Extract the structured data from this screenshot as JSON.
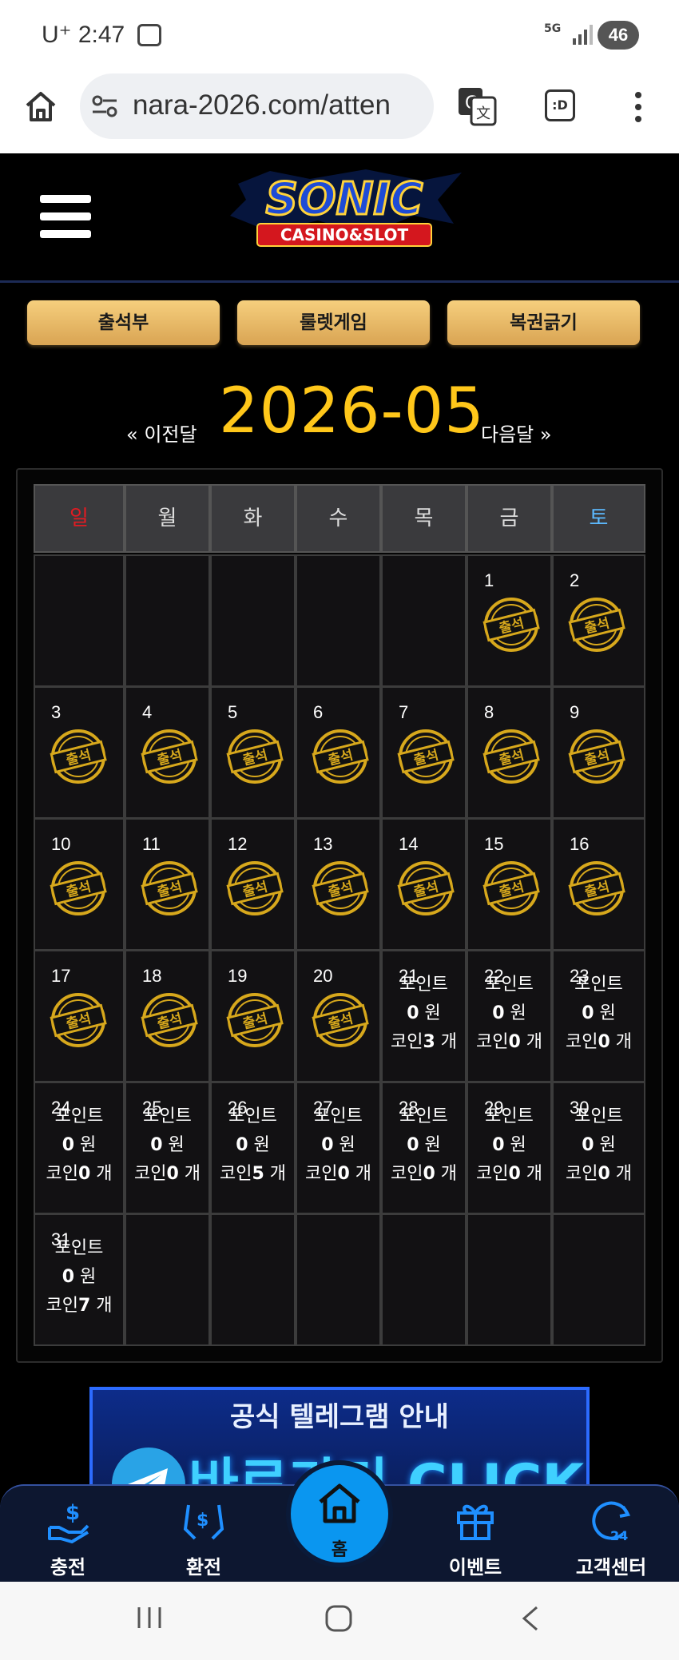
{
  "status_bar": {
    "carrier": "U⁺",
    "time": "2:47",
    "network": "5G",
    "battery": "46"
  },
  "browser": {
    "url": "nara-2026.com/atten",
    "tabs_label": ":D"
  },
  "logo": {
    "main": "SONIC",
    "sub": "CASINO&SLOT"
  },
  "tabs": [
    {
      "label": "출석부"
    },
    {
      "label": "룰렛게임"
    },
    {
      "label": "복권긁기"
    }
  ],
  "month_nav": {
    "prev": "« 이전달",
    "title": "2026-05",
    "next": "다음달 »"
  },
  "calendar": {
    "weekdays": [
      "일",
      "월",
      "화",
      "수",
      "목",
      "금",
      "토"
    ],
    "weekday_colors": {
      "sun": "#e11b22",
      "sat": "#5cb9ff",
      "default": "#dddddd"
    },
    "stamp_text": "출석",
    "point_label": "포인트",
    "won_unit": "원",
    "coin_label": "코인",
    "coin_unit": "개",
    "days": [
      {
        "day": "1",
        "attended": true
      },
      {
        "day": "2",
        "attended": true
      },
      {
        "day": "3",
        "attended": true
      },
      {
        "day": "4",
        "attended": true
      },
      {
        "day": "5",
        "attended": true
      },
      {
        "day": "6",
        "attended": true
      },
      {
        "day": "7",
        "attended": true
      },
      {
        "day": "8",
        "attended": true
      },
      {
        "day": "9",
        "attended": true
      },
      {
        "day": "10",
        "attended": true
      },
      {
        "day": "11",
        "attended": true
      },
      {
        "day": "12",
        "attended": true
      },
      {
        "day": "13",
        "attended": true
      },
      {
        "day": "14",
        "attended": true
      },
      {
        "day": "15",
        "attended": true
      },
      {
        "day": "16",
        "attended": true
      },
      {
        "day": "17",
        "attended": true
      },
      {
        "day": "18",
        "attended": true
      },
      {
        "day": "19",
        "attended": true
      },
      {
        "day": "20",
        "attended": true
      },
      {
        "day": "21",
        "attended": false,
        "points": "0",
        "coins": "3"
      },
      {
        "day": "22",
        "attended": false,
        "points": "0",
        "coins": "0"
      },
      {
        "day": "23",
        "attended": false,
        "points": "0",
        "coins": "0"
      },
      {
        "day": "24",
        "attended": false,
        "points": "0",
        "coins": "0"
      },
      {
        "day": "25",
        "attended": false,
        "points": "0",
        "coins": "0"
      },
      {
        "day": "26",
        "attended": false,
        "points": "0",
        "coins": "5"
      },
      {
        "day": "27",
        "attended": false,
        "points": "0",
        "coins": "0"
      },
      {
        "day": "28",
        "attended": false,
        "points": "0",
        "coins": "0"
      },
      {
        "day": "29",
        "attended": false,
        "points": "0",
        "coins": "0"
      },
      {
        "day": "30",
        "attended": false,
        "points": "0",
        "coins": "0"
      },
      {
        "day": "31",
        "attended": false,
        "points": "0",
        "coins": "7"
      }
    ],
    "first_weekday_index": 5
  },
  "banner": {
    "title": "공식 텔레그램 안내",
    "cta": "바로가기 CLICK"
  },
  "bottom_nav": [
    {
      "label": "충전",
      "icon": "deposit-icon"
    },
    {
      "label": "환전",
      "icon": "exchange-icon"
    },
    {
      "label": "홈",
      "icon": "home-icon"
    },
    {
      "label": "이벤트",
      "icon": "gift-icon"
    },
    {
      "label": "고객센터",
      "icon": "support-24-icon"
    }
  ],
  "colors": {
    "accent_gold": "#ffc71a",
    "tab_gold": "#e8b865",
    "nav_blue": "#0a96f0"
  }
}
